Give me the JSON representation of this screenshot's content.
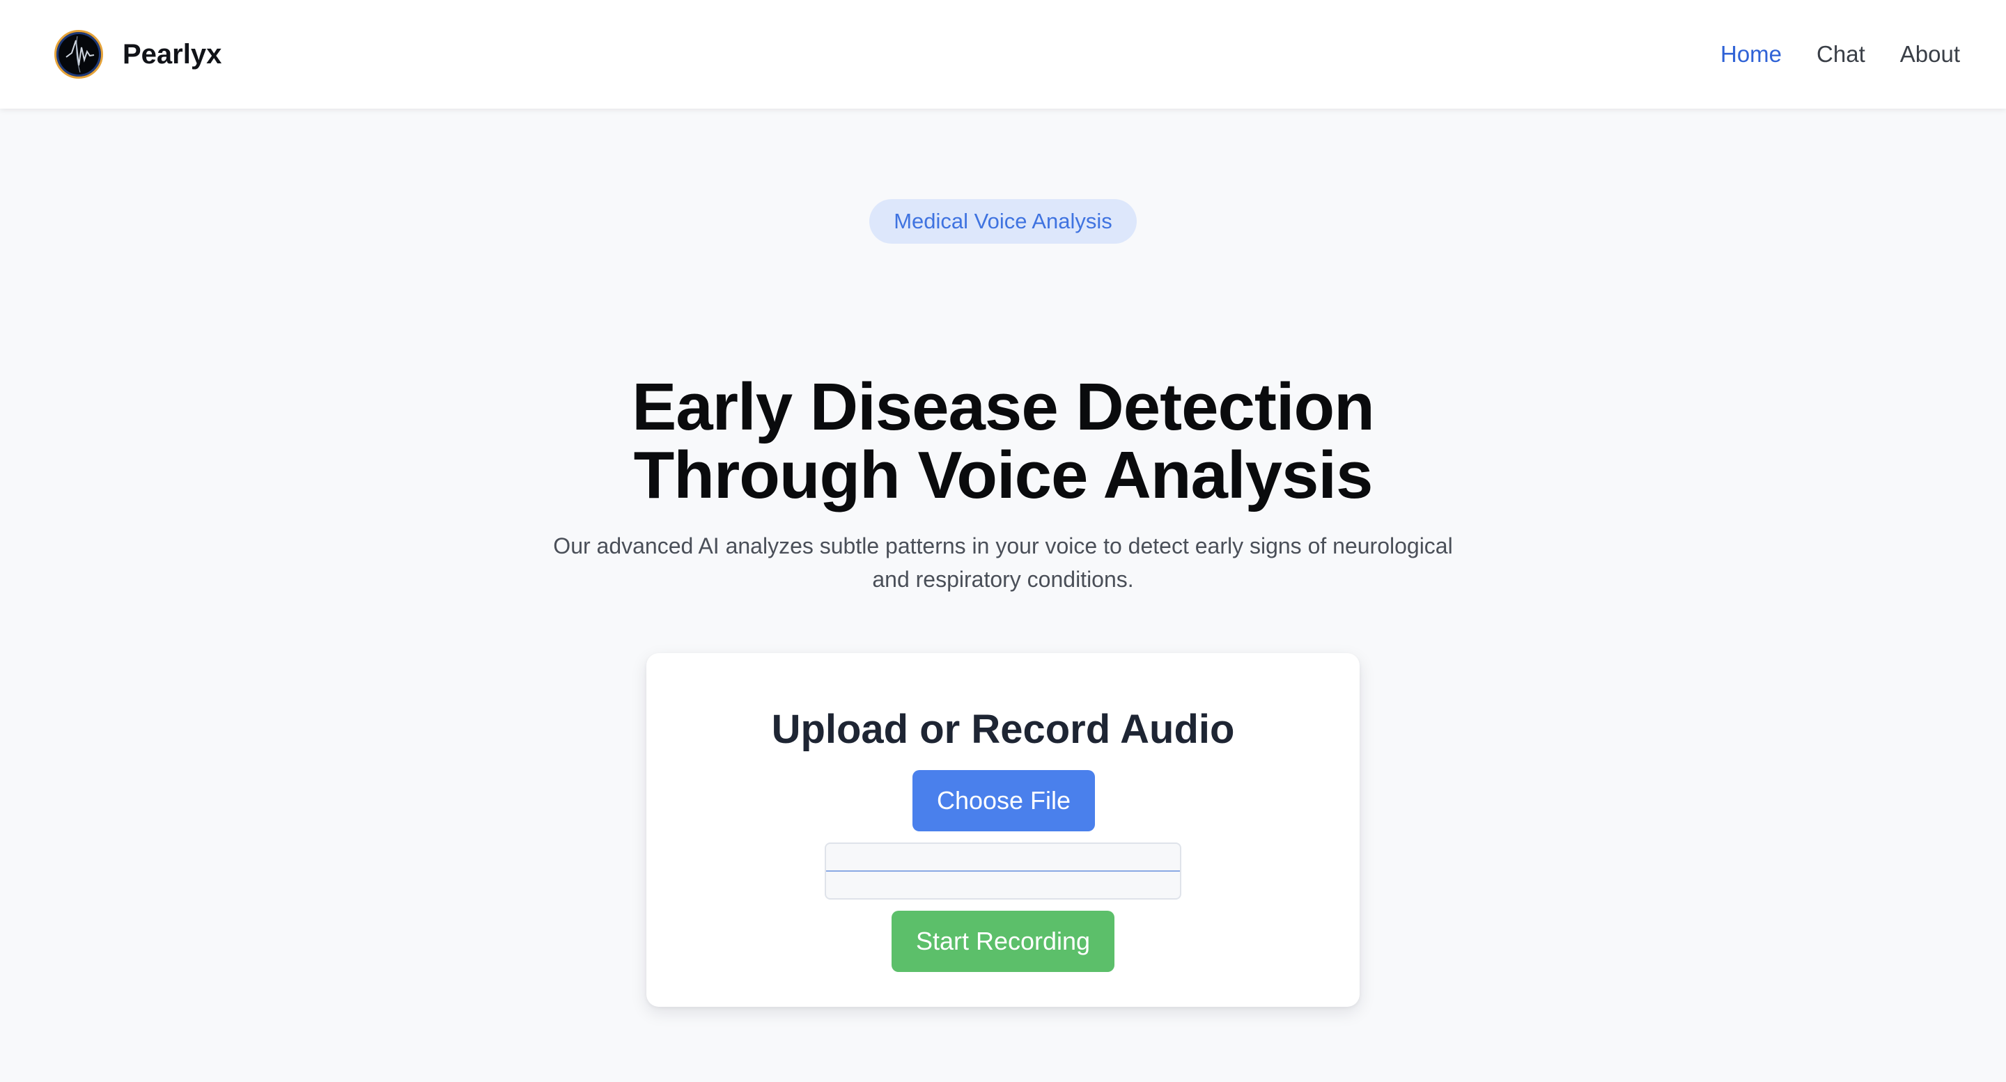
{
  "header": {
    "brand_name": "Pearlyx",
    "logo_icon": "voice-waveform-icon",
    "nav": [
      {
        "label": "Home",
        "active": true
      },
      {
        "label": "Chat",
        "active": false
      },
      {
        "label": "About",
        "active": false
      }
    ]
  },
  "hero": {
    "badge": "Medical Voice Analysis",
    "title_line1": "Early Disease Detection",
    "title_line2": "Through Voice Analysis",
    "subtitle_line1": "Our advanced AI analyzes subtle patterns in your voice to detect early signs of neurological",
    "subtitle_line2": "and respiratory conditions."
  },
  "upload_card": {
    "title": "Upload or Record Audio",
    "choose_file_label": "Choose File",
    "start_recording_label": "Start Recording"
  },
  "colors": {
    "accent": "#2f62d6",
    "button_blue": "#4a80ec",
    "button_green": "#5cbf6a",
    "badge_bg": "#dde7fb",
    "page_bg": "#f8f9fb"
  }
}
